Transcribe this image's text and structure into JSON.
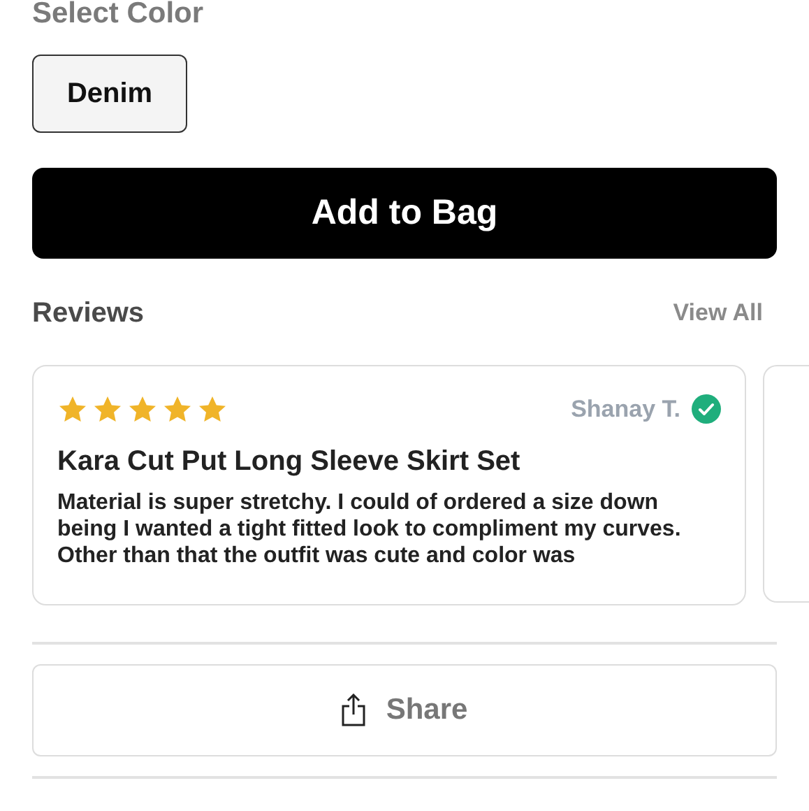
{
  "color_section": {
    "title": "Select Color",
    "options": [
      {
        "label": "Denim",
        "selected": true
      }
    ]
  },
  "add_button": "Add to Bag",
  "reviews": {
    "title": "Reviews",
    "view_all": "View All",
    "items": [
      {
        "stars": 5,
        "author": "Shanay T.",
        "verified": true,
        "title": "Kara Cut Put Long Sleeve Skirt Set",
        "body": "Material is super stretchy. I could of ordered a size down being I wanted a tight fitted look to compliment my curves. Other than that the outfit was cute and color was"
      }
    ],
    "next_card_peek": true
  },
  "share_button": "Share"
}
